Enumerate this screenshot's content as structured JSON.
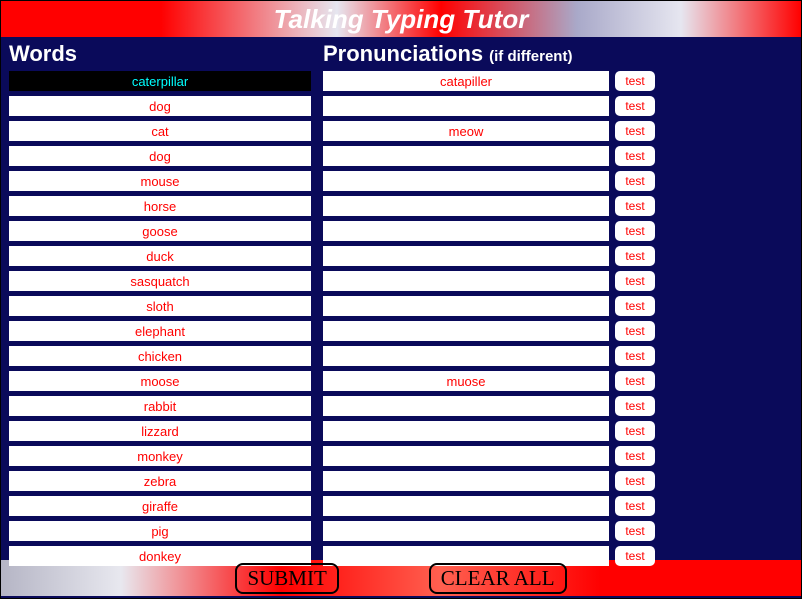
{
  "title": "Talking Typing Tutor",
  "headers": {
    "words": "Words",
    "pron": "Pronunciations",
    "pron_sub": "(if different)"
  },
  "test_label": "test",
  "footer": {
    "submit": "SUBMIT",
    "clear": "CLEAR ALL"
  },
  "rows": [
    {
      "word": "caterpillar",
      "pron": "catapiller",
      "selected": true
    },
    {
      "word": "dog",
      "pron": ""
    },
    {
      "word": "cat",
      "pron": "meow"
    },
    {
      "word": "dog",
      "pron": ""
    },
    {
      "word": "mouse",
      "pron": ""
    },
    {
      "word": "horse",
      "pron": ""
    },
    {
      "word": "goose",
      "pron": ""
    },
    {
      "word": "duck",
      "pron": ""
    },
    {
      "word": "sasquatch",
      "pron": ""
    },
    {
      "word": "sloth",
      "pron": ""
    },
    {
      "word": "elephant",
      "pron": ""
    },
    {
      "word": "chicken",
      "pron": ""
    },
    {
      "word": "moose",
      "pron": "muose"
    },
    {
      "word": "rabbit",
      "pron": ""
    },
    {
      "word": "lizzard",
      "pron": ""
    },
    {
      "word": "monkey",
      "pron": ""
    },
    {
      "word": "zebra",
      "pron": ""
    },
    {
      "word": "giraffe",
      "pron": ""
    },
    {
      "word": "pig",
      "pron": ""
    },
    {
      "word": "donkey",
      "pron": ""
    }
  ]
}
